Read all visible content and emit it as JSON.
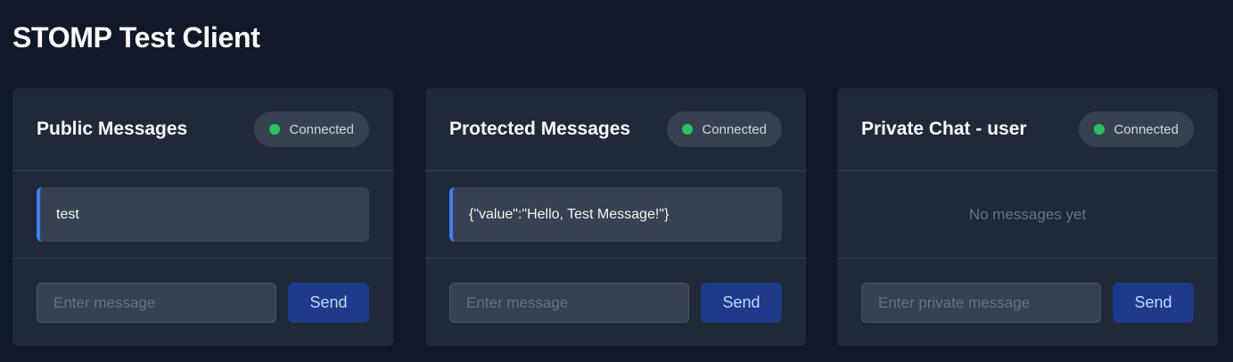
{
  "page": {
    "title": "STOMP Test Client"
  },
  "colors": {
    "background": "#111827",
    "panel": "#1f2937",
    "status_connected": "#22c55e",
    "message_accent": "#3b82f6",
    "send_button": "#1e3a8a"
  },
  "panels": [
    {
      "title": "Public Messages",
      "status": "Connected",
      "messages": [
        "test"
      ],
      "empty_text": "",
      "input_placeholder": "Enter message",
      "send_label": "Send"
    },
    {
      "title": "Protected Messages",
      "status": "Connected",
      "messages": [
        "{\"value\":\"Hello, Test Message!\"}"
      ],
      "empty_text": "",
      "input_placeholder": "Enter message",
      "send_label": "Send"
    },
    {
      "title": "Private Chat - user",
      "status": "Connected",
      "messages": [],
      "empty_text": "No messages yet",
      "input_placeholder": "Enter private message",
      "send_label": "Send"
    }
  ]
}
